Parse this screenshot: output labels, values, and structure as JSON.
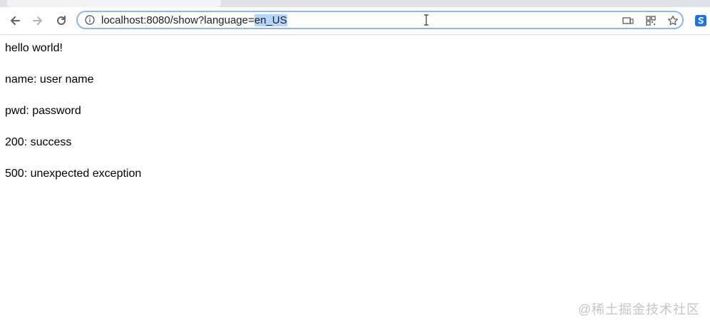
{
  "browser": {
    "url_base": "localhost:8080/show?language=",
    "url_selected": "en_US"
  },
  "content": {
    "lines": [
      "hello world!",
      "name: user name",
      "pwd: password",
      "200: success",
      "500: unexpected exception"
    ]
  },
  "watermark": "@稀土掘金技术社区",
  "icons": {
    "back": "arrow-left-icon",
    "forward": "arrow-right-icon",
    "reload": "reload-icon",
    "info": "info-icon",
    "cast": "cast-icon",
    "qr": "qr-code-icon",
    "bookmark": "star-icon",
    "extension": "extension-icon"
  },
  "colors": {
    "omnibox_focus": "#8ab4f8",
    "selection": "#b3d4fc",
    "tabstrip": "#dee1e6"
  }
}
